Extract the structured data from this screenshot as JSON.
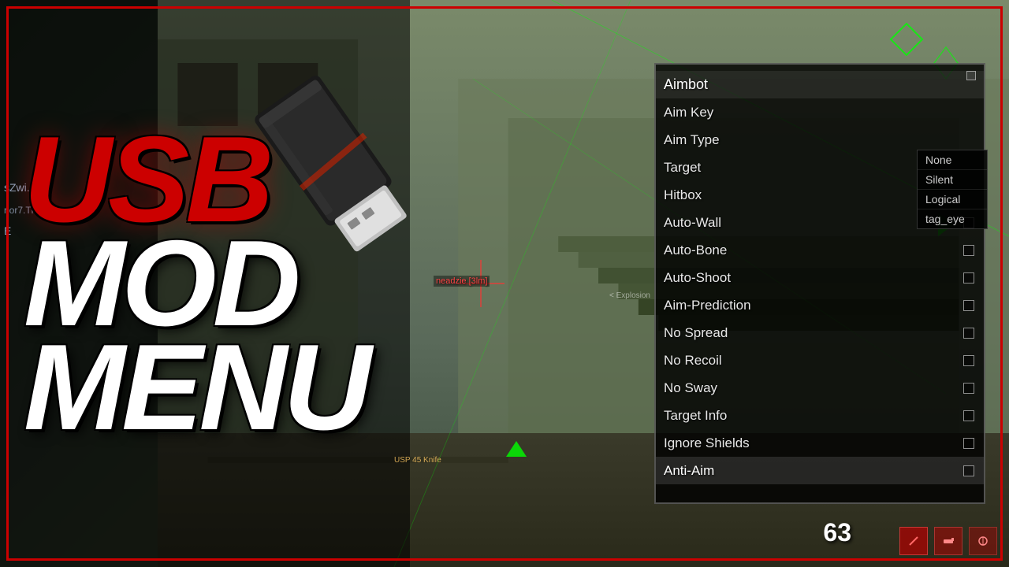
{
  "title": "USB MOD MENU",
  "title_parts": {
    "usb": "USB",
    "mod": "MOD",
    "menu": "MENU"
  },
  "menu": {
    "title": "Aimbot",
    "corner_marker_label": "☐",
    "items": [
      {
        "label": "Aimbot",
        "type": "header",
        "checkbox": false
      },
      {
        "label": "Aim Key",
        "type": "item",
        "checkbox": false,
        "has_dropdown": false
      },
      {
        "label": "Aim Type",
        "type": "item",
        "checkbox": false,
        "has_dropdown": true
      },
      {
        "label": "Target",
        "type": "item",
        "checkbox": false,
        "has_dropdown": false
      },
      {
        "label": "Hitbox",
        "type": "item",
        "checkbox": false,
        "has_dropdown": false
      },
      {
        "label": "Auto-Wall",
        "type": "item",
        "checkbox": true
      },
      {
        "label": "Auto-Bone",
        "type": "item",
        "checkbox": true
      },
      {
        "label": "Auto-Shoot",
        "type": "item",
        "checkbox": true
      },
      {
        "label": "Aim-Prediction",
        "type": "item",
        "checkbox": true
      },
      {
        "label": "No Spread",
        "type": "item",
        "checkbox": true
      },
      {
        "label": "No Recoil",
        "type": "item",
        "checkbox": true
      },
      {
        "label": "No Sway",
        "type": "item",
        "checkbox": true
      },
      {
        "label": "Target Info",
        "type": "item",
        "checkbox": true
      },
      {
        "label": "Ignore Shields",
        "type": "item",
        "checkbox": true
      },
      {
        "label": "Anti-Aim",
        "type": "item",
        "checkbox": true
      }
    ],
    "dropdown_options": [
      {
        "label": "None",
        "selected": false
      },
      {
        "label": "Silent",
        "selected": false
      },
      {
        "label": "Logical",
        "selected": false
      },
      {
        "label": "tag_eye",
        "selected": false
      }
    ]
  },
  "game_ui": {
    "score": "63",
    "player_tag": "neadzie [3lm]",
    "weapon_info": "USP 45 Knife",
    "sub_names": [
      "sZwi...",
      "rior7.Th...",
      "E"
    ]
  },
  "colors": {
    "usb_red": "#cc0000",
    "menu_bg": "rgba(0,0,0,0.82)",
    "text_white": "#e8e8e8",
    "green_laser": "#00ff00",
    "border_red": "#cc0000"
  }
}
